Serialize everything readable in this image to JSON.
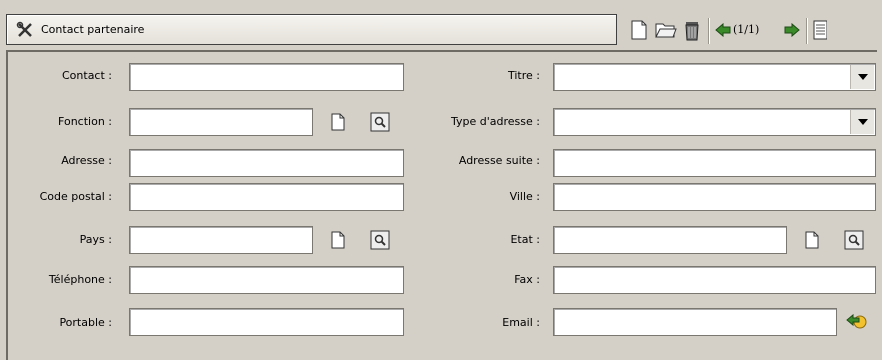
{
  "window": {
    "title": "Contact partenaire",
    "pager": "(1/1)"
  },
  "toolbar": {
    "icons": [
      "new-document-icon",
      "open-folder-icon",
      "trash-icon",
      "previous-arrow-icon",
      "next-arrow-icon",
      "list-view-icon"
    ]
  },
  "form": {
    "contact": {
      "label": "Contact :",
      "value": ""
    },
    "fonction": {
      "label": "Fonction :",
      "value": ""
    },
    "adresse": {
      "label": "Adresse :",
      "value": ""
    },
    "code_postal": {
      "label": "Code postal :",
      "value": ""
    },
    "pays": {
      "label": "Pays :",
      "value": ""
    },
    "telephone": {
      "label": "Téléphone :",
      "value": ""
    },
    "portable": {
      "label": "Portable :",
      "value": ""
    },
    "titre": {
      "label": "Titre :",
      "value": ""
    },
    "type_adresse": {
      "label": "Type d'adresse :",
      "value": ""
    },
    "adresse_suite": {
      "label": "Adresse suite :",
      "value": ""
    },
    "ville": {
      "label": "Ville :",
      "value": ""
    },
    "etat": {
      "label": "Etat :",
      "value": ""
    },
    "fax": {
      "label": "Fax :",
      "value": ""
    },
    "email": {
      "label": "Email :",
      "value": ""
    }
  },
  "colors": {
    "background": "#d4d0c8",
    "field_bg": "#ffffff",
    "arrow_green": "#3a8a2a"
  }
}
